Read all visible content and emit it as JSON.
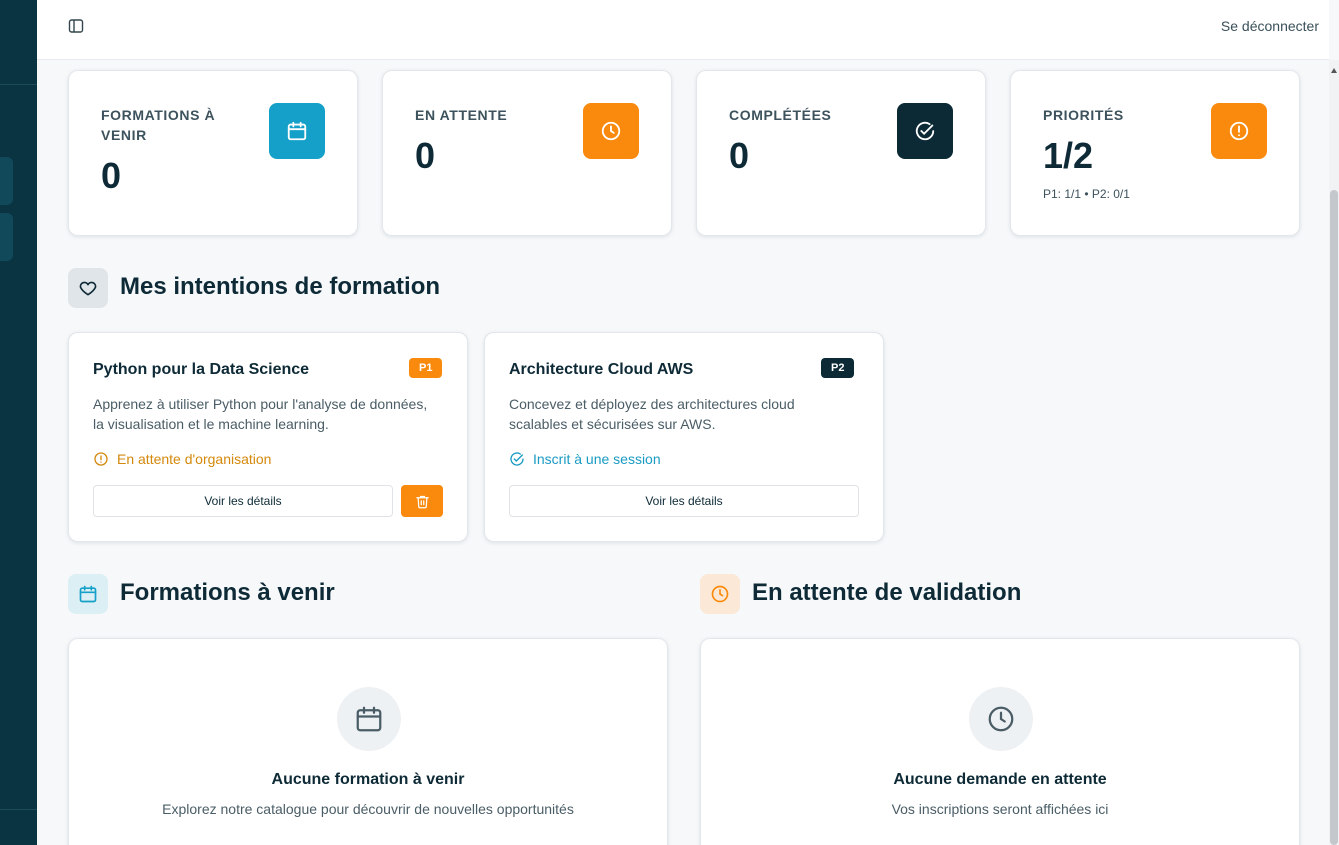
{
  "topbar": {
    "logout_label": "Se déconnecter"
  },
  "stats": [
    {
      "label": "FORMATIONS À VENIR",
      "value": "0",
      "icon": "calendar-icon",
      "color": "#14a0c8"
    },
    {
      "label": "EN ATTENTE",
      "value": "0",
      "icon": "clock-icon",
      "color": "#f98a0d"
    },
    {
      "label": "COMPLÉTÉES",
      "value": "0",
      "icon": "check-circle-icon",
      "color": "#0b2a36"
    },
    {
      "label": "PRIORITÉS",
      "value": "1/2",
      "sub": "P1: 1/1 • P2: 0/1",
      "icon": "alert-circle-icon",
      "color": "#f98a0d"
    }
  ],
  "intentions": {
    "title": "Mes intentions de formation",
    "items": [
      {
        "title": "Python pour la Data Science",
        "badge": "P1",
        "badge_color": "#f98a0d",
        "description": "Apprenez à utiliser Python pour l'analyse de données, la visualisation et le machine learning.",
        "status": "En attente d'organisation",
        "status_color": "#d4890c",
        "details_label": "Voir les détails"
      },
      {
        "title": "Architecture Cloud AWS",
        "badge": "P2",
        "badge_color": "#0b2a36",
        "description": "Concevez et déployez des architectures cloud scalables et sécurisées sur AWS.",
        "status": "Inscrit à une session",
        "status_color": "#1a9bc3",
        "details_label": "Voir les détails"
      }
    ]
  },
  "upcoming": {
    "title": "Formations à venir",
    "empty_title": "Aucune formation à venir",
    "empty_sub": "Explorez notre catalogue pour découvrir de nouvelles opportunités"
  },
  "pending": {
    "title": "En attente de validation",
    "empty_title": "Aucune demande en attente",
    "empty_sub": "Vos inscriptions seront affichées ici"
  }
}
